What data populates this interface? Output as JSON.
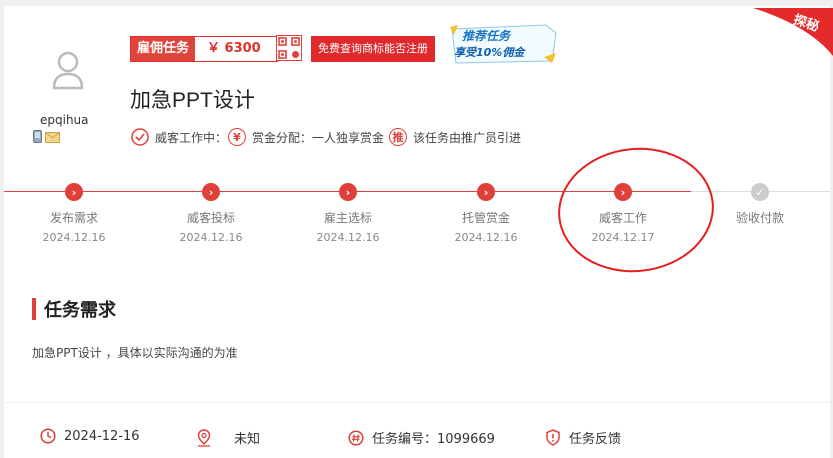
{
  "user": {
    "name": "epqihua"
  },
  "reward": {
    "label": "雇佣任务",
    "amount": "￥ 6300"
  },
  "free_button": "免费查询商标能否注册",
  "promo": {
    "line1": "推荐任务",
    "line2": "享受10%佣金"
  },
  "corner_badge": "探秘",
  "task_title": "加急PPT设计",
  "meta": [
    {
      "icon": "check-circle-icon",
      "text": "威客工作中："
    },
    {
      "icon": "yuan-circle-icon",
      "glyph": "¥",
      "text": "赏金分配：一人独享赏金"
    },
    {
      "icon": "recommend-circle-icon",
      "glyph": "推",
      "text": "该任务由推广员引进"
    }
  ],
  "steps": [
    {
      "name": "发布需求",
      "date": "2024.12.16",
      "done": true
    },
    {
      "name": "威客投标",
      "date": "2024.12.16",
      "done": true
    },
    {
      "name": "雇主选标",
      "date": "2024.12.16",
      "done": true
    },
    {
      "name": "托管赏金",
      "date": "2024.12.16",
      "done": true
    },
    {
      "name": "威客工作",
      "date": "2024.12.17",
      "done": true
    },
    {
      "name": "验收付款",
      "date": "",
      "done": false
    }
  ],
  "requirement": {
    "heading": "任务需求",
    "text": "加急PPT设计 ，具体以实际沟通的为准"
  },
  "footer": {
    "date": "2024-12-16",
    "location": "未知",
    "task_number": "任务编号：1099669",
    "feedback": "任务反馈"
  },
  "colors": {
    "accent": "#e0403a",
    "pending": "#cccccc",
    "annotation": "#e51e1e"
  }
}
